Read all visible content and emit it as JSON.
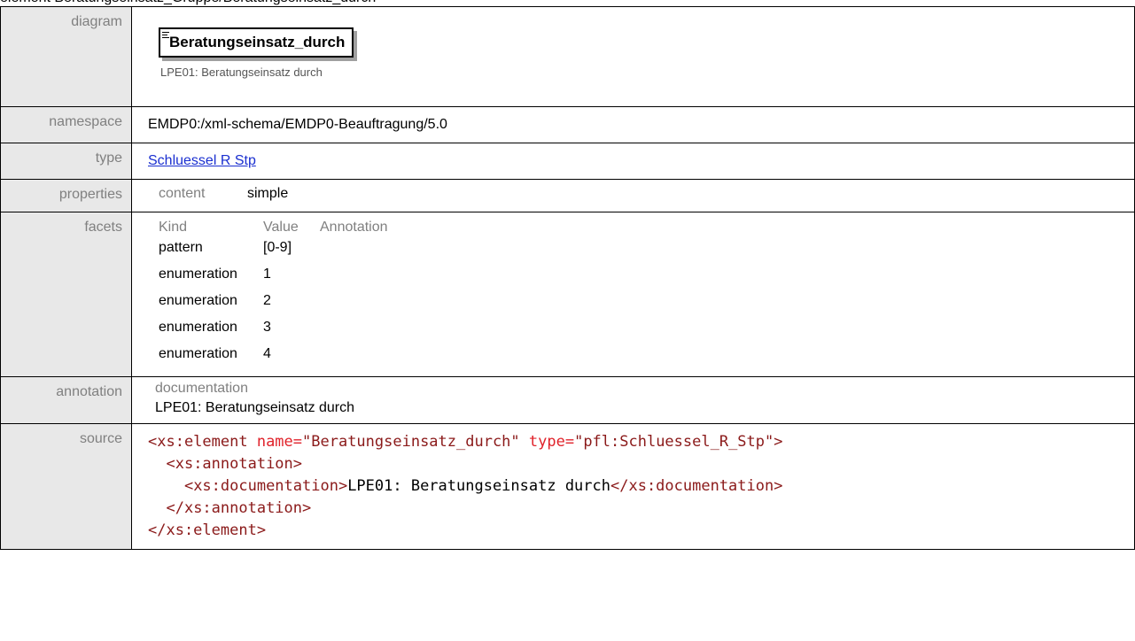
{
  "title": "element Beratungseinsatz_Gruppe/Beratungseinsatz_durch",
  "diagram": {
    "label": "diagram",
    "element_name": "Beratungseinsatz_durch",
    "element_doc": "LPE01: Beratungseinsatz durch"
  },
  "namespace": {
    "label": "namespace",
    "value": "EMDP0:/xml-schema/EMDP0-Beauftragung/5.0"
  },
  "type": {
    "label": "type",
    "value": "Schluessel R Stp"
  },
  "properties": {
    "label": "properties",
    "key": "content",
    "value": "simple"
  },
  "facets": {
    "label": "facets",
    "headers": [
      "Kind",
      "Value",
      "Annotation"
    ],
    "rows": [
      {
        "kind": "pattern",
        "value": "[0-9]",
        "annotation": ""
      },
      {
        "kind": "enumeration",
        "value": "1",
        "annotation": ""
      },
      {
        "kind": "enumeration",
        "value": "2",
        "annotation": ""
      },
      {
        "kind": "enumeration",
        "value": "3",
        "annotation": ""
      },
      {
        "kind": "enumeration",
        "value": "4",
        "annotation": ""
      }
    ]
  },
  "annotation": {
    "label": "annotation",
    "key": "documentation",
    "value": "LPE01: Beratungseinsatz durch"
  },
  "source": {
    "label": "source",
    "lines": [
      {
        "indent": "",
        "open": "<xs:element",
        "attr1_name": " name=",
        "attr1_val": "\"Beratungseinsatz_durch\"",
        "attr2_name": " type=",
        "attr2_val": "\"pfl:Schluessel_R_Stp\"",
        "close": ">"
      },
      {
        "indent": "  ",
        "tag": "<xs:annotation>"
      },
      {
        "indent": "    ",
        "tag": "<xs:documentation>",
        "text": "LPE01: Beratungseinsatz durch",
        "endtag": "</xs:documentation>"
      },
      {
        "indent": "  ",
        "tag": "</xs:annotation>"
      },
      {
        "indent": "",
        "tag": "</xs:element>"
      }
    ]
  },
  "colors": {
    "label_bg": "#e8e8e8",
    "link": "#1a2fd0",
    "xml_tag": "#8b1a1a",
    "xml_attr": "#e0222a"
  }
}
